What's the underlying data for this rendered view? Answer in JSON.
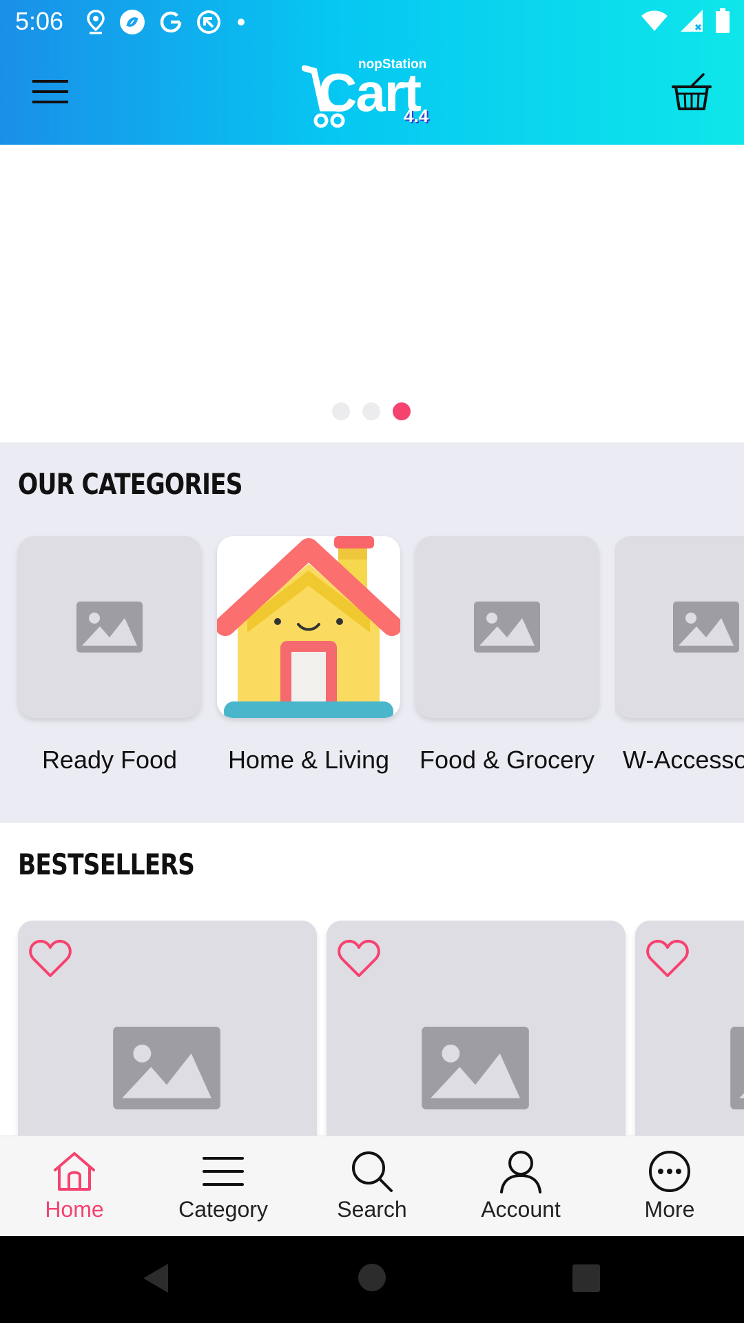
{
  "status_bar": {
    "time": "5:06",
    "left_icons": [
      "location-icon",
      "app-icon",
      "google-icon",
      "sync-icon",
      "dot-icon"
    ],
    "right_icons": [
      "wifi-icon",
      "signal-icon",
      "battery-icon"
    ]
  },
  "app_bar": {
    "logo_brand": "nopStation",
    "logo_word": "Cart",
    "logo_version": "4.4",
    "menu_icon": "menu-icon",
    "cart_icon": "basket-icon"
  },
  "banner": {
    "slides": 3,
    "active_slide": 3
  },
  "categories": {
    "title": "OUR CATEGORIES",
    "items": [
      {
        "label": "Ready Food",
        "image": "placeholder-image-icon"
      },
      {
        "label": "Home &  Living",
        "image": "house-illustration"
      },
      {
        "label": "Food & Grocery",
        "image": "placeholder-image-icon"
      },
      {
        "label": "W-Accesso",
        "image": "placeholder-image-icon"
      }
    ]
  },
  "bestsellers": {
    "title": "BESTSELLERS",
    "items": [
      {
        "favorite_icon": "heart-outline-icon",
        "image": "placeholder-image-icon"
      },
      {
        "favorite_icon": "heart-outline-icon",
        "image": "placeholder-image-icon"
      },
      {
        "favorite_icon": "heart-outline-icon",
        "image": "placeholder-image-icon"
      }
    ]
  },
  "bottom_nav": {
    "items": [
      {
        "label": "Home",
        "icon": "home-icon",
        "active": true
      },
      {
        "label": "Category",
        "icon": "menu-lines-icon",
        "active": false
      },
      {
        "label": "Search",
        "icon": "search-icon",
        "active": false
      },
      {
        "label": "Account",
        "icon": "user-icon",
        "active": false
      },
      {
        "label": "More",
        "icon": "more-icon",
        "active": false
      }
    ]
  },
  "system_nav": {
    "buttons": [
      "back-icon",
      "home-circle-icon",
      "recents-icon"
    ]
  },
  "colors": {
    "accent": "#f6426f",
    "header_start": "#1a8fe8",
    "header_end": "#0ee6ea",
    "category_bg": "#ebebf3",
    "placeholder_card": "#dedde3",
    "placeholder_icon": "#9e9da3"
  }
}
